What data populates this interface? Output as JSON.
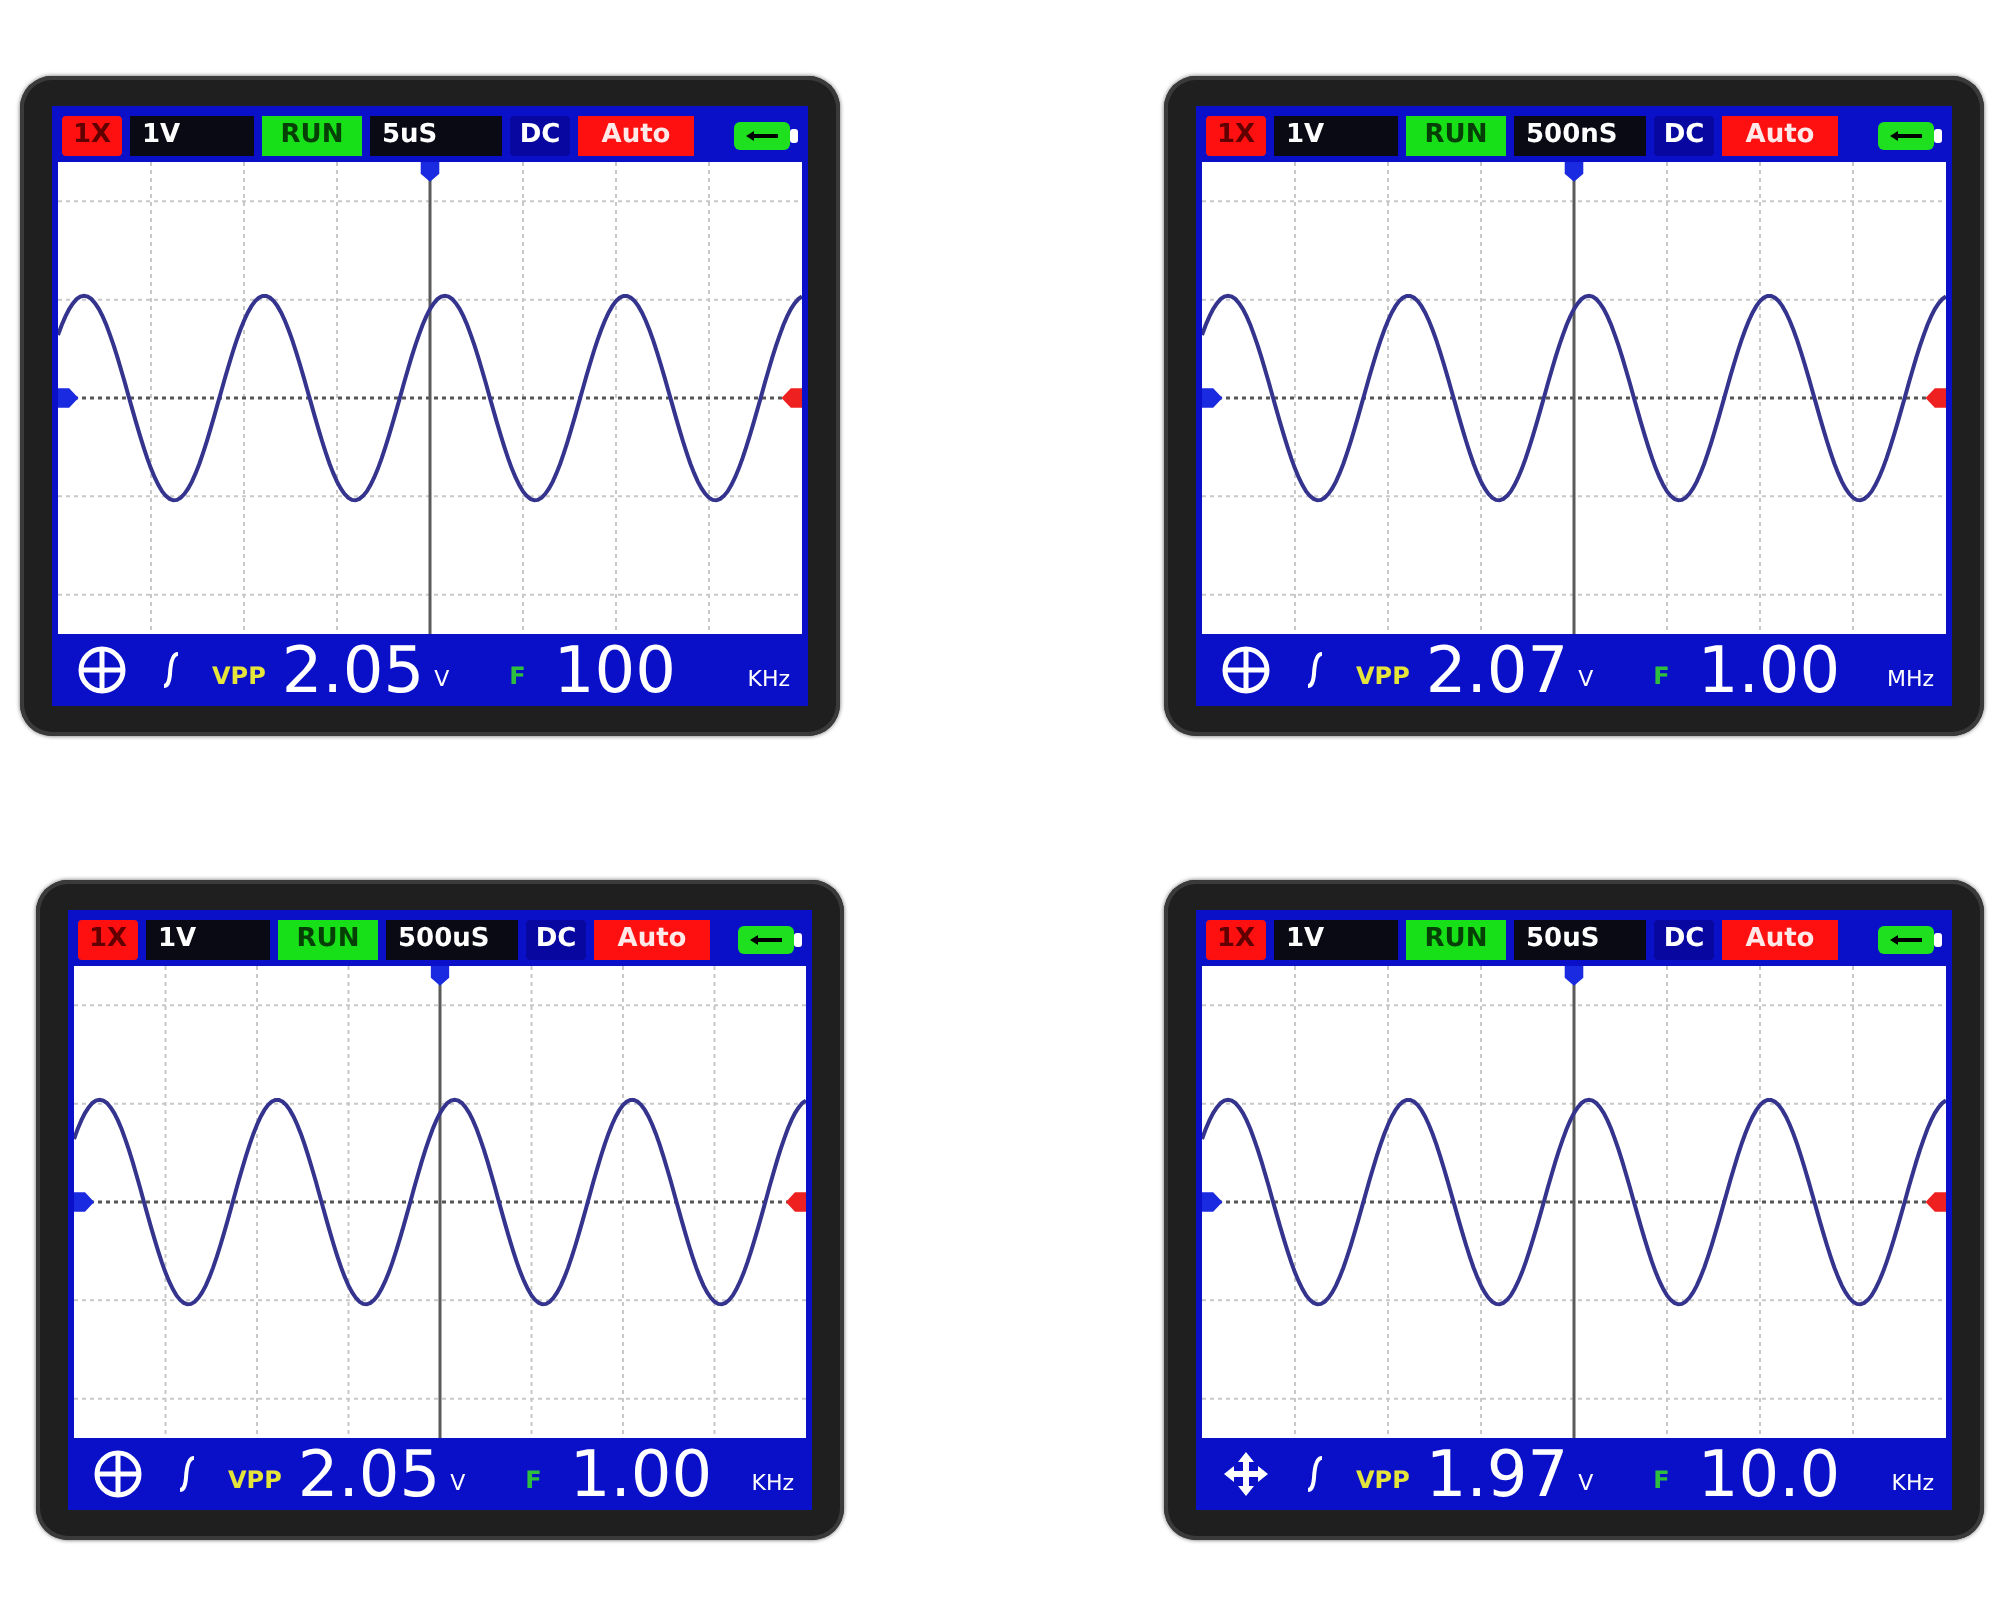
{
  "screens": [
    {
      "probe": "1X",
      "volts_per_div": "1V",
      "run_status": "RUN",
      "time_per_div": "5uS",
      "coupling": "DC",
      "trigger_mode": "Auto",
      "vpp_label": "VPP",
      "vpp_value": "2.05",
      "vpp_unit": "V",
      "freq_label": "F",
      "freq_value": "100",
      "freq_unit": "KHz"
    },
    {
      "probe": "1X",
      "volts_per_div": "1V",
      "run_status": "RUN",
      "time_per_div": "500nS",
      "coupling": "DC",
      "trigger_mode": "Auto",
      "vpp_label": "VPP",
      "vpp_value": "2.07",
      "vpp_unit": "V",
      "freq_label": "F",
      "freq_value": "1.00",
      "freq_unit": "MHz"
    },
    {
      "probe": "1X",
      "volts_per_div": "1V",
      "run_status": "RUN",
      "time_per_div": "500uS",
      "coupling": "DC",
      "trigger_mode": "Auto",
      "vpp_label": "VPP",
      "vpp_value": "2.05",
      "vpp_unit": "V",
      "freq_label": "F",
      "freq_value": "1.00",
      "freq_unit": "KHz"
    },
    {
      "probe": "1X",
      "volts_per_div": "1V",
      "run_status": "RUN",
      "time_per_div": "50uS",
      "coupling": "DC",
      "trigger_mode": "Auto",
      "vpp_label": "VPP",
      "vpp_value": "1.97",
      "vpp_unit": "V",
      "freq_label": "F",
      "freq_value": "10.0",
      "freq_unit": "KHz"
    }
  ]
}
